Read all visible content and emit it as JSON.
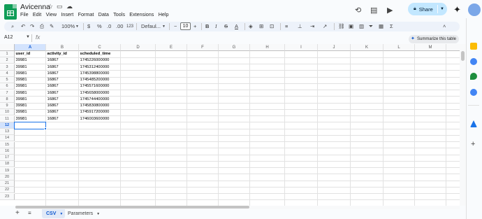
{
  "app": {
    "title": "Avicenna",
    "menu": [
      "File",
      "Edit",
      "View",
      "Insert",
      "Format",
      "Data",
      "Tools",
      "Extensions",
      "Help"
    ],
    "share_label": "Share"
  },
  "toolbar": {
    "zoom": "100%",
    "currency": "$",
    "percent": "%",
    "decimal_decrease": ".0",
    "decimal_increase": ".00",
    "number_format": "123",
    "font": "Defaul...",
    "font_size": "10"
  },
  "formula_bar": {
    "name_box": "A12",
    "fx": "fx",
    "summarize_label": "Summarize this table"
  },
  "grid": {
    "columns": [
      "A",
      "B",
      "C",
      "D",
      "E",
      "F",
      "G",
      "H",
      "I",
      "J",
      "K",
      "L",
      "M",
      "N"
    ],
    "rows": [
      "1",
      "2",
      "3",
      "4",
      "5",
      "6",
      "7",
      "8",
      "9",
      "10",
      "11",
      "12",
      "13",
      "14",
      "15",
      "16",
      "17",
      "18",
      "19",
      "20",
      "21",
      "22",
      "23"
    ],
    "header": [
      "user_id",
      "activity_id",
      "scheduled_time"
    ],
    "data": [
      [
        "39981",
        "16867",
        "1745226000000"
      ],
      [
        "39981",
        "16867",
        "1745312400000"
      ],
      [
        "39981",
        "16867",
        "1745398800000"
      ],
      [
        "39981",
        "16867",
        "1745485200000"
      ],
      [
        "39981",
        "16867",
        "1745571600000"
      ],
      [
        "39981",
        "16867",
        "1745658000000"
      ],
      [
        "39981",
        "16867",
        "1745744400000"
      ],
      [
        "39981",
        "16867",
        "1745830800000"
      ],
      [
        "39981",
        "16867",
        "1745917200000"
      ],
      [
        "39981",
        "16867",
        "1746003600000"
      ]
    ],
    "selected_cell": "A12"
  },
  "sheets": [
    {
      "label": "CSV",
      "active": true
    },
    {
      "label": "Parameters",
      "active": false
    }
  ],
  "colors": {
    "accent": "#0b57d0",
    "share_bg": "#c2e7ff",
    "selection": "#1a73e8"
  }
}
